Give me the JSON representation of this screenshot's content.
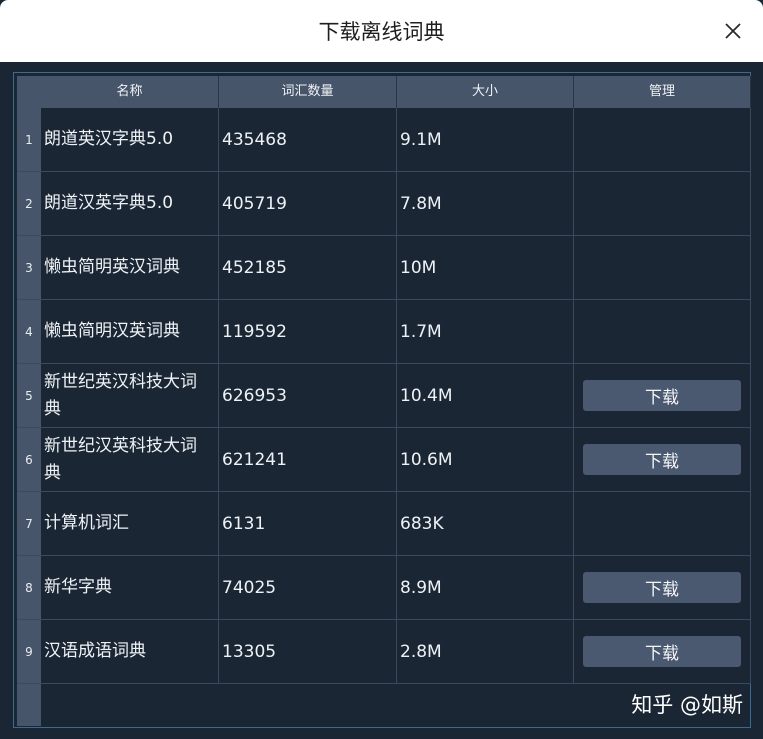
{
  "window": {
    "title": "下载离线词典"
  },
  "table": {
    "columns": [
      "名称",
      "词汇数量",
      "大小",
      "管理"
    ],
    "rows": [
      {
        "num": "1",
        "name": "朗道英汉字典5.0",
        "count": "435468",
        "size": "9.1M",
        "action": ""
      },
      {
        "num": "2",
        "name": "朗道汉英字典5.0",
        "count": "405719",
        "size": "7.8M",
        "action": ""
      },
      {
        "num": "3",
        "name": "懒虫简明英汉词典",
        "count": "452185",
        "size": "10M",
        "action": ""
      },
      {
        "num": "4",
        "name": "懒虫简明汉英词典",
        "count": "119592",
        "size": "1.7M",
        "action": ""
      },
      {
        "num": "5",
        "name": "新世纪英汉科技大词典",
        "count": "626953",
        "size": "10.4M",
        "action": "下载"
      },
      {
        "num": "6",
        "name": "新世纪汉英科技大词典",
        "count": "621241",
        "size": "10.6M",
        "action": "下载"
      },
      {
        "num": "7",
        "name": "计算机词汇",
        "count": "6131",
        "size": "683K",
        "action": ""
      },
      {
        "num": "8",
        "name": "新华字典",
        "count": "74025",
        "size": "8.9M",
        "action": "下载"
      },
      {
        "num": "9",
        "name": "汉语成语词典",
        "count": "13305",
        "size": "2.8M",
        "action": "下载"
      }
    ]
  },
  "watermark": "知乎 @如斯"
}
